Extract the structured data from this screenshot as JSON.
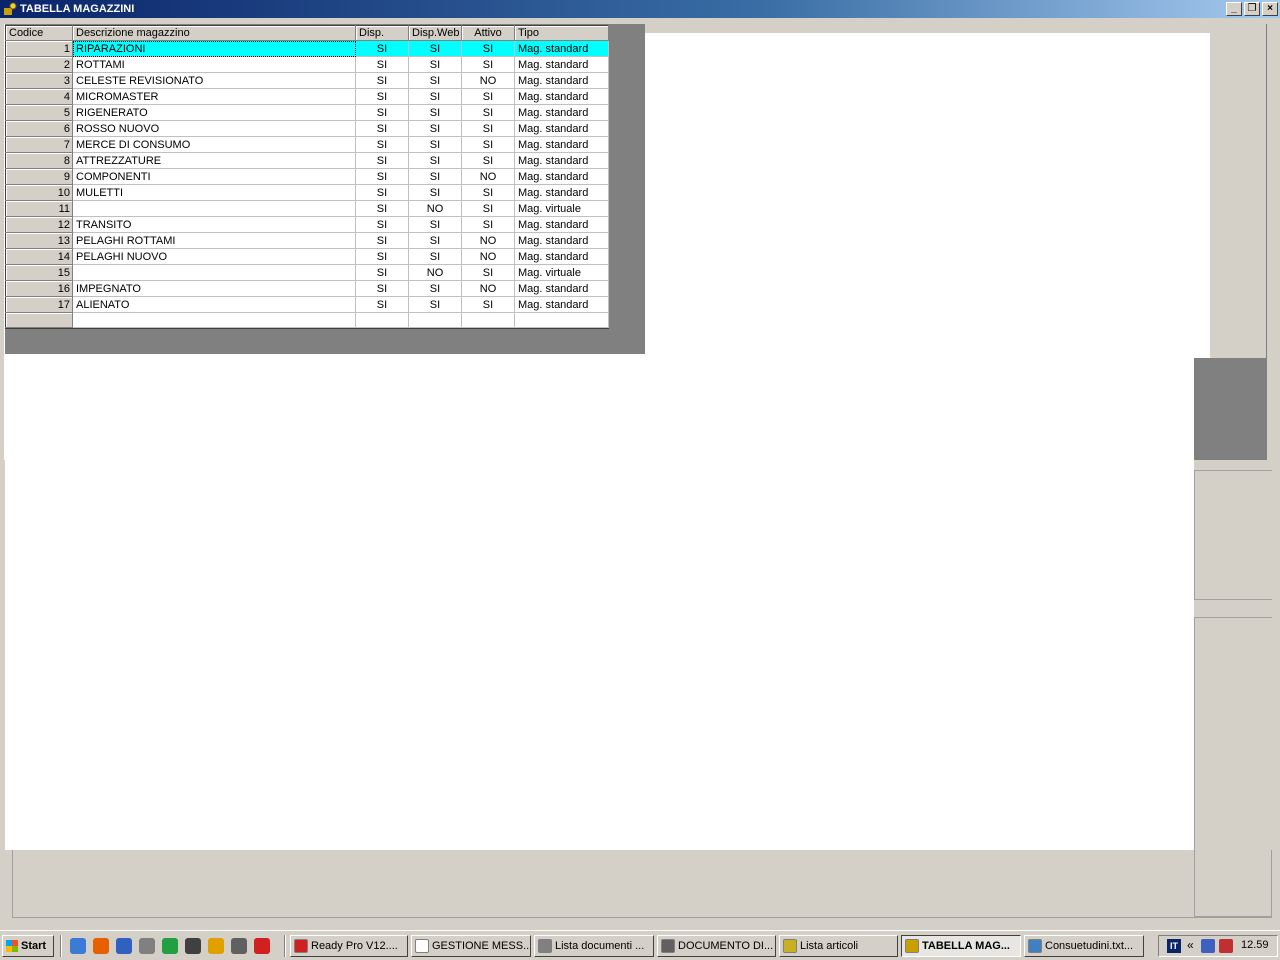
{
  "window": {
    "title": "TABELLA MAGAZZINI",
    "buttons": {
      "minimize": "_",
      "restore": "❐",
      "close": "×"
    }
  },
  "grid": {
    "headers": [
      "Codice",
      "Descrizione magazzino",
      "Disp.",
      "Disp.Web",
      "Attivo",
      "Tipo"
    ],
    "selected_row": 0,
    "rows": [
      {
        "codice": "1",
        "descrizione": "RIPARAZIONI",
        "disp": "SI",
        "disp_web": "SI",
        "attivo": "SI",
        "tipo": "Mag. standard"
      },
      {
        "codice": "2",
        "descrizione": "ROTTAMI",
        "disp": "SI",
        "disp_web": "SI",
        "attivo": "SI",
        "tipo": "Mag. standard"
      },
      {
        "codice": "3",
        "descrizione": "CELESTE REVISIONATO",
        "disp": "SI",
        "disp_web": "SI",
        "attivo": "NO",
        "tipo": "Mag. standard"
      },
      {
        "codice": "4",
        "descrizione": "MICROMASTER",
        "disp": "SI",
        "disp_web": "SI",
        "attivo": "SI",
        "tipo": "Mag. standard"
      },
      {
        "codice": "5",
        "descrizione": "RIGENERATO",
        "disp": "SI",
        "disp_web": "SI",
        "attivo": "SI",
        "tipo": "Mag. standard"
      },
      {
        "codice": "6",
        "descrizione": "ROSSO NUOVO",
        "disp": "SI",
        "disp_web": "SI",
        "attivo": "SI",
        "tipo": "Mag. standard"
      },
      {
        "codice": "7",
        "descrizione": "MERCE DI CONSUMO",
        "disp": "SI",
        "disp_web": "SI",
        "attivo": "SI",
        "tipo": "Mag. standard"
      },
      {
        "codice": "8",
        "descrizione": "ATTREZZATURE",
        "disp": "SI",
        "disp_web": "SI",
        "attivo": "SI",
        "tipo": "Mag. standard"
      },
      {
        "codice": "9",
        "descrizione": "COMPONENTI",
        "disp": "SI",
        "disp_web": "SI",
        "attivo": "NO",
        "tipo": "Mag. standard"
      },
      {
        "codice": "10",
        "descrizione": "MULETTI",
        "disp": "SI",
        "disp_web": "SI",
        "attivo": "SI",
        "tipo": "Mag. standard"
      },
      {
        "codice": "11",
        "descrizione": "",
        "disp": "SI",
        "disp_web": "NO",
        "attivo": "SI",
        "tipo": "Mag. virtuale"
      },
      {
        "codice": "12",
        "descrizione": "TRANSITO",
        "disp": "SI",
        "disp_web": "SI",
        "attivo": "SI",
        "tipo": "Mag. standard"
      },
      {
        "codice": "13",
        "descrizione": "PELAGHI ROTTAMI",
        "disp": "SI",
        "disp_web": "SI",
        "attivo": "NO",
        "tipo": "Mag. standard"
      },
      {
        "codice": "14",
        "descrizione": "PELAGHI NUOVO",
        "disp": "SI",
        "disp_web": "SI",
        "attivo": "NO",
        "tipo": "Mag. standard"
      },
      {
        "codice": "15",
        "descrizione": "",
        "disp": "SI",
        "disp_web": "NO",
        "attivo": "SI",
        "tipo": "Mag. virtuale"
      },
      {
        "codice": "16",
        "descrizione": "IMPEGNATO",
        "disp": "SI",
        "disp_web": "SI",
        "attivo": "NO",
        "tipo": "Mag. standard"
      },
      {
        "codice": "17",
        "descrizione": "ALIENATO",
        "disp": "SI",
        "disp_web": "SI",
        "attivo": "SI",
        "tipo": "Mag. standard"
      }
    ]
  },
  "taskbar": {
    "start_label": "Start",
    "quick_launch": [
      "outlook-express-icon",
      "firefox-icon",
      "browser-icon",
      "printer-icon",
      "arrow-icon",
      "media-icon",
      "messenger-icon",
      "tool-icon",
      "ready-pro-icon"
    ],
    "tasks": [
      {
        "label": "Ready Pro V12....",
        "icon": "ready-pro-icon",
        "active": false
      },
      {
        "label": "GESTIONE MESS...",
        "icon": "message-icon",
        "active": false
      },
      {
        "label": "Lista documenti ...",
        "icon": "document-list-icon",
        "active": false
      },
      {
        "label": "DOCUMENTO DI...",
        "icon": "document-icon",
        "active": false
      },
      {
        "label": "Lista articoli",
        "icon": "articles-icon",
        "active": false
      },
      {
        "label": "TABELLA MAG...",
        "icon": "warehouse-icon",
        "active": true
      },
      {
        "label": "Consuetudini.txt...",
        "icon": "notepad-icon",
        "active": false
      }
    ],
    "tray": {
      "language": "IT",
      "chevron": "«",
      "clock": "12.59"
    }
  },
  "colors": {
    "selection": "#00ffff",
    "titlebar": "#0a246a",
    "face": "#d4d0c8"
  }
}
